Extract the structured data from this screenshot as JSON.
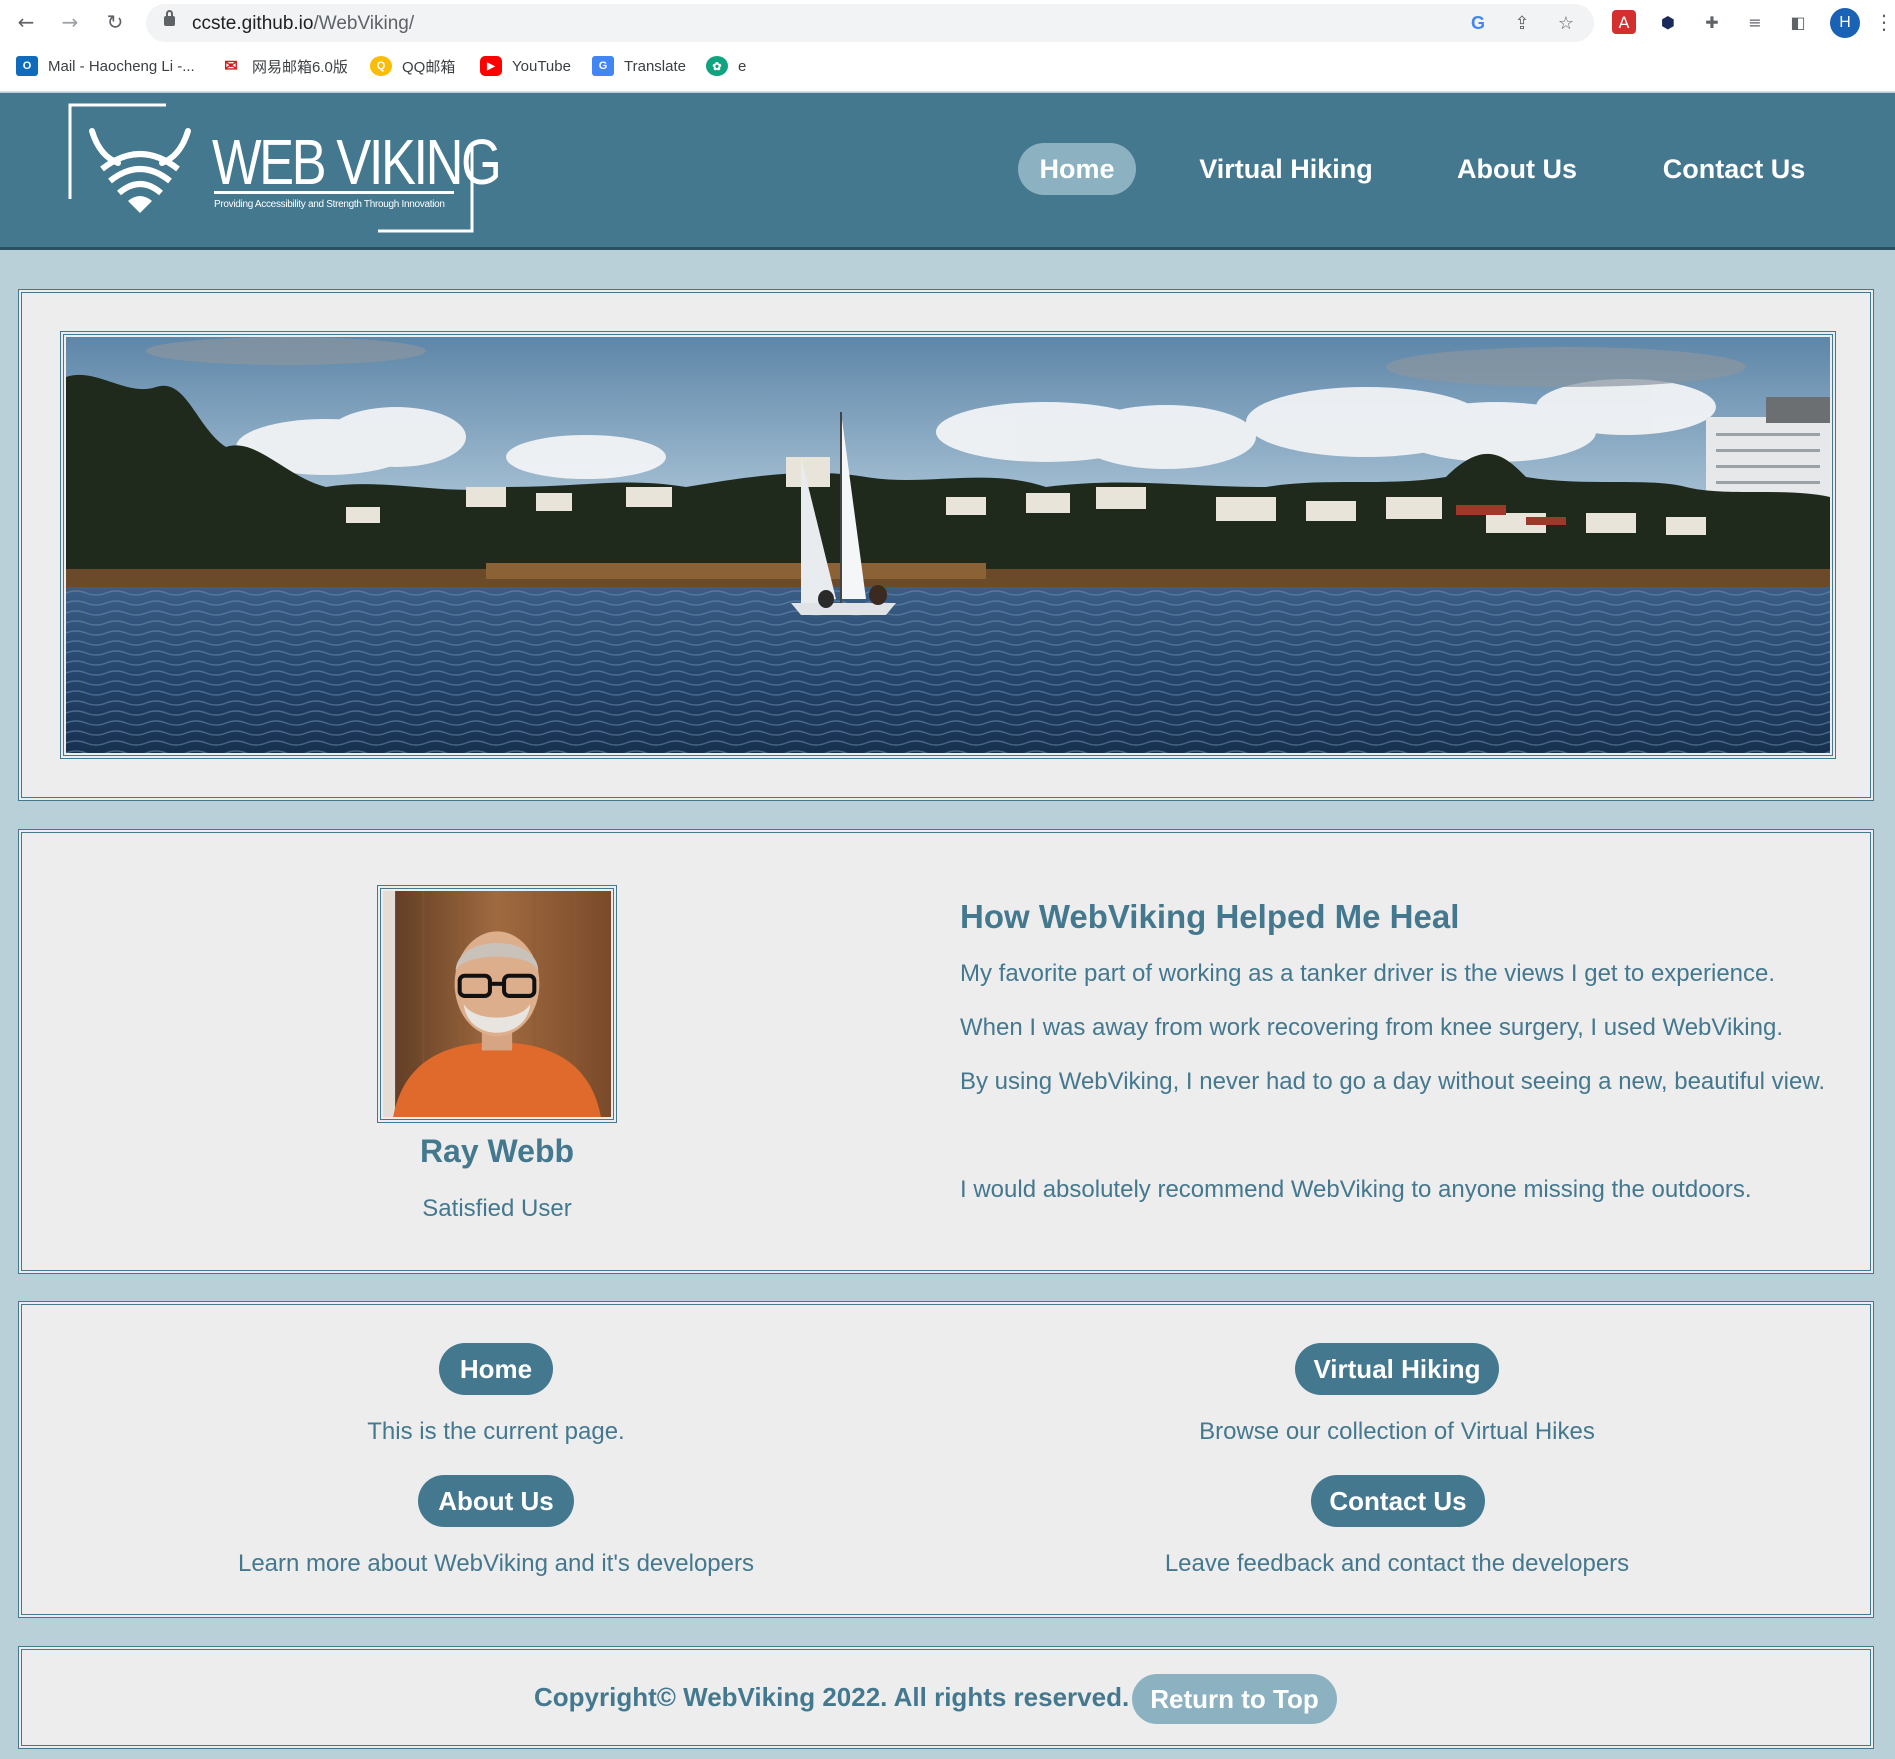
{
  "browser": {
    "url_host": "ccste.github.io",
    "url_path": "/WebViking/",
    "profile_initial": "H",
    "bookmarks": [
      {
        "label": "Mail - Haocheng Li -...",
        "icon": "outlook-icon"
      },
      {
        "label": "网易邮箱6.0版",
        "icon": "netease-mail-icon"
      },
      {
        "label": "QQ邮箱",
        "icon": "qq-mail-icon"
      },
      {
        "label": "YouTube",
        "icon": "youtube-icon"
      },
      {
        "label": "Translate",
        "icon": "google-translate-icon"
      },
      {
        "label": "e",
        "icon": "chatgpt-icon"
      }
    ]
  },
  "header": {
    "logo_title": "WEB VIKING",
    "logo_tagline": "Providing Accessibility and Strength Through Innovation",
    "nav": [
      {
        "label": "Home",
        "active": true
      },
      {
        "label": "Virtual Hiking",
        "active": false
      },
      {
        "label": "About Us",
        "active": false
      },
      {
        "label": "Contact Us",
        "active": false
      }
    ]
  },
  "testimonial": {
    "name": "Ray Webb",
    "role": "Satisfied User",
    "title": "How WebViking Helped Me Heal",
    "paragraphs": [
      "My favorite part of working as a tanker driver is the views I get to experience.",
      "When I was away from work recovering from knee surgery, I used WebViking.",
      "By using WebViking, I never had to go a day without seeing a new, beautiful view.",
      "I would absolutely recommend WebViking to anyone missing the outdoors."
    ]
  },
  "quick_links": [
    {
      "label": "Home",
      "description": "This is the current page."
    },
    {
      "label": "Virtual Hiking",
      "description": "Browse our collection of Virtual Hikes"
    },
    {
      "label": "About Us",
      "description": "Learn more about WebViking and it's developers"
    },
    {
      "label": "Contact Us",
      "description": "Leave feedback and contact the developers"
    }
  ],
  "footer": {
    "copyright": "Copyright© WebViking 2022. All rights reserved.",
    "return_top": "Return to Top"
  },
  "colors": {
    "brand": "#44788f",
    "brand_light": "#8cb2c2",
    "page_bg": "#b9d0d8",
    "panel_bg": "#ededed"
  }
}
